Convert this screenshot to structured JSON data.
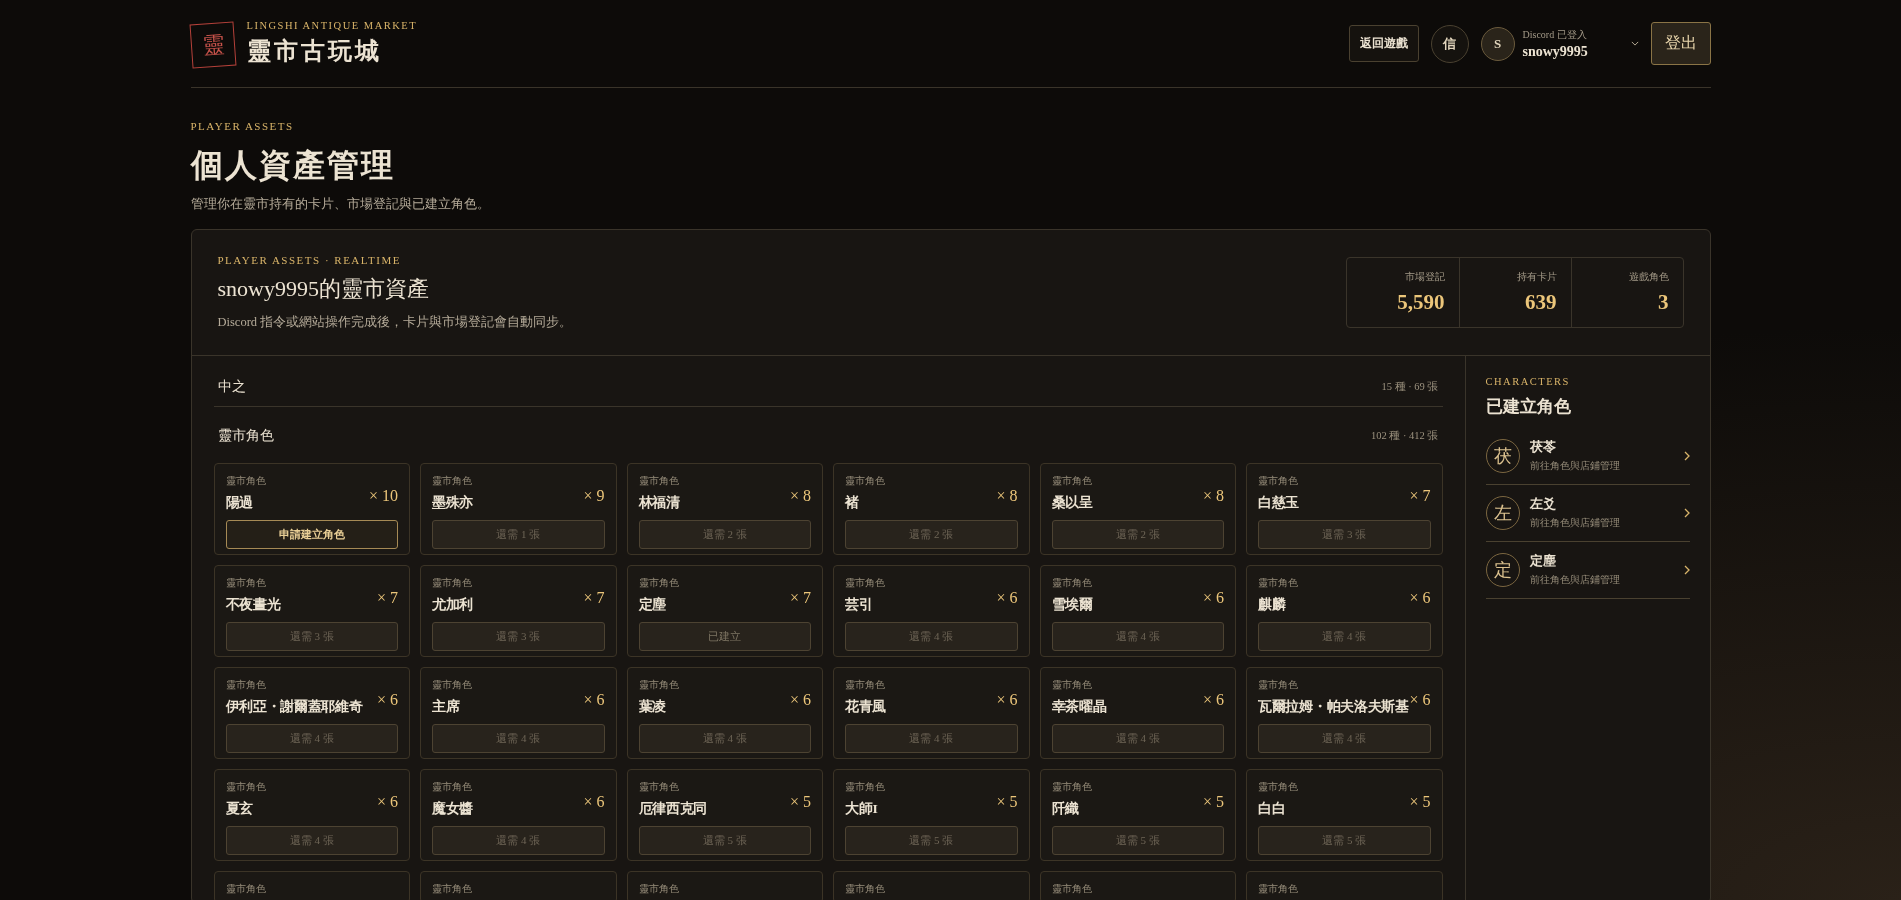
{
  "header": {
    "logo_glyph": "靈",
    "eyebrow": "LINGSHI ANTIQUE MARKET",
    "brand": "靈市古玩城",
    "back_button": "返回遊戲",
    "mail_button": "信",
    "user": {
      "avatar": "S",
      "status": "Discord 已登入",
      "name": "snowy9995"
    },
    "logout_button": "登出"
  },
  "page": {
    "eyebrow": "PLAYER ASSETS",
    "title": "個人資產管理",
    "subtitle": "管理你在靈市持有的卡片、市場登記與已建立角色。"
  },
  "summary": {
    "eyebrow": "PLAYER ASSETS · REALTIME",
    "title": "snowy9995的靈市資產",
    "note": "Discord 指令或網站操作完成後，卡片與市場登記會自動同步。",
    "stats": [
      {
        "label": "市場登記",
        "value": "5,590"
      },
      {
        "label": "持有卡片",
        "value": "639"
      },
      {
        "label": "遊戲角色",
        "value": "3"
      }
    ]
  },
  "groups": [
    {
      "name": "中之",
      "count": "15 種 · 69 張"
    },
    {
      "name": "靈市角色",
      "count": "102 種 · 412 張",
      "cards": [
        {
          "label": "靈市角色",
          "name": "陽過",
          "count": "× 10",
          "action": {
            "kind": "apply",
            "text": "申請建立角色"
          }
        },
        {
          "label": "靈市角色",
          "name": "墨殊亦",
          "count": "× 9",
          "action": {
            "kind": "need",
            "text": "還需 1 張"
          }
        },
        {
          "label": "靈市角色",
          "name": "林福清",
          "count": "× 8",
          "action": {
            "kind": "need",
            "text": "還需 2 張"
          }
        },
        {
          "label": "靈市角色",
          "name": "褚",
          "count": "× 8",
          "action": {
            "kind": "need",
            "text": "還需 2 張"
          }
        },
        {
          "label": "靈市角色",
          "name": "桑以呈",
          "count": "× 8",
          "action": {
            "kind": "need",
            "text": "還需 2 張"
          }
        },
        {
          "label": "靈市角色",
          "name": "白慈玉",
          "count": "× 7",
          "action": {
            "kind": "need",
            "text": "還需 3 張"
          }
        },
        {
          "label": "靈市角色",
          "name": "不夜晝光",
          "count": "× 7",
          "action": {
            "kind": "need",
            "text": "還需 3 張"
          }
        },
        {
          "label": "靈市角色",
          "name": "尤加利",
          "count": "× 7",
          "action": {
            "kind": "need",
            "text": "還需 3 張"
          }
        },
        {
          "label": "靈市角色",
          "name": "定塵",
          "count": "× 7",
          "action": {
            "kind": "created",
            "text": "已建立"
          }
        },
        {
          "label": "靈市角色",
          "name": "芸引",
          "count": "× 6",
          "action": {
            "kind": "need",
            "text": "還需 4 張"
          }
        },
        {
          "label": "靈市角色",
          "name": "雪埃爾",
          "count": "× 6",
          "action": {
            "kind": "need",
            "text": "還需 4 張"
          }
        },
        {
          "label": "靈市角色",
          "name": "麒麟",
          "count": "× 6",
          "action": {
            "kind": "need",
            "text": "還需 4 張"
          }
        },
        {
          "label": "靈市角色",
          "name": "伊利亞・謝爾蓋耶維奇",
          "count": "× 6",
          "action": {
            "kind": "need",
            "text": "還需 4 張"
          }
        },
        {
          "label": "靈市角色",
          "name": "主席",
          "count": "× 6",
          "action": {
            "kind": "need",
            "text": "還需 4 張"
          }
        },
        {
          "label": "靈市角色",
          "name": "葉凌",
          "count": "× 6",
          "action": {
            "kind": "need",
            "text": "還需 4 張"
          }
        },
        {
          "label": "靈市角色",
          "name": "花青風",
          "count": "× 6",
          "action": {
            "kind": "need",
            "text": "還需 4 張"
          }
        },
        {
          "label": "靈市角色",
          "name": "幸茶曜晶",
          "count": "× 6",
          "action": {
            "kind": "need",
            "text": "還需 4 張"
          }
        },
        {
          "label": "靈市角色",
          "name": "瓦爾拉姆・帕夫洛夫斯基",
          "count": "× 6",
          "action": {
            "kind": "need",
            "text": "還需 4 張"
          }
        },
        {
          "label": "靈市角色",
          "name": "夏玄",
          "count": "× 6",
          "action": {
            "kind": "need",
            "text": "還需 4 張"
          }
        },
        {
          "label": "靈市角色",
          "name": "魔女醬",
          "count": "× 6",
          "action": {
            "kind": "need",
            "text": "還需 4 張"
          }
        },
        {
          "label": "靈市角色",
          "name": "厄律西克同",
          "count": "× 5",
          "action": {
            "kind": "need",
            "text": "還需 5 張"
          }
        },
        {
          "label": "靈市角色",
          "name": "大師I",
          "count": "× 5",
          "action": {
            "kind": "need",
            "text": "還需 5 張"
          }
        },
        {
          "label": "靈市角色",
          "name": "阡織",
          "count": "× 5",
          "action": {
            "kind": "need",
            "text": "還需 5 張"
          }
        },
        {
          "label": "靈市角色",
          "name": "白白",
          "count": "× 5",
          "action": {
            "kind": "need",
            "text": "還需 5 張"
          }
        },
        {
          "label": "靈市角色"
        },
        {
          "label": "靈市角色"
        },
        {
          "label": "靈市角色"
        },
        {
          "label": "靈市角色"
        },
        {
          "label": "靈市角色"
        },
        {
          "label": "靈市角色"
        }
      ]
    }
  ],
  "characters": {
    "eyebrow": "CHARACTERS",
    "title": "已建立角色",
    "items": [
      {
        "glyph": "茯",
        "name": "茯苓",
        "subtitle": "前往角色與店鋪管理"
      },
      {
        "glyph": "左",
        "name": "左爻",
        "subtitle": "前往角色與店鋪管理"
      },
      {
        "glyph": "定",
        "name": "定塵",
        "subtitle": "前往角色與店鋪管理"
      }
    ]
  }
}
